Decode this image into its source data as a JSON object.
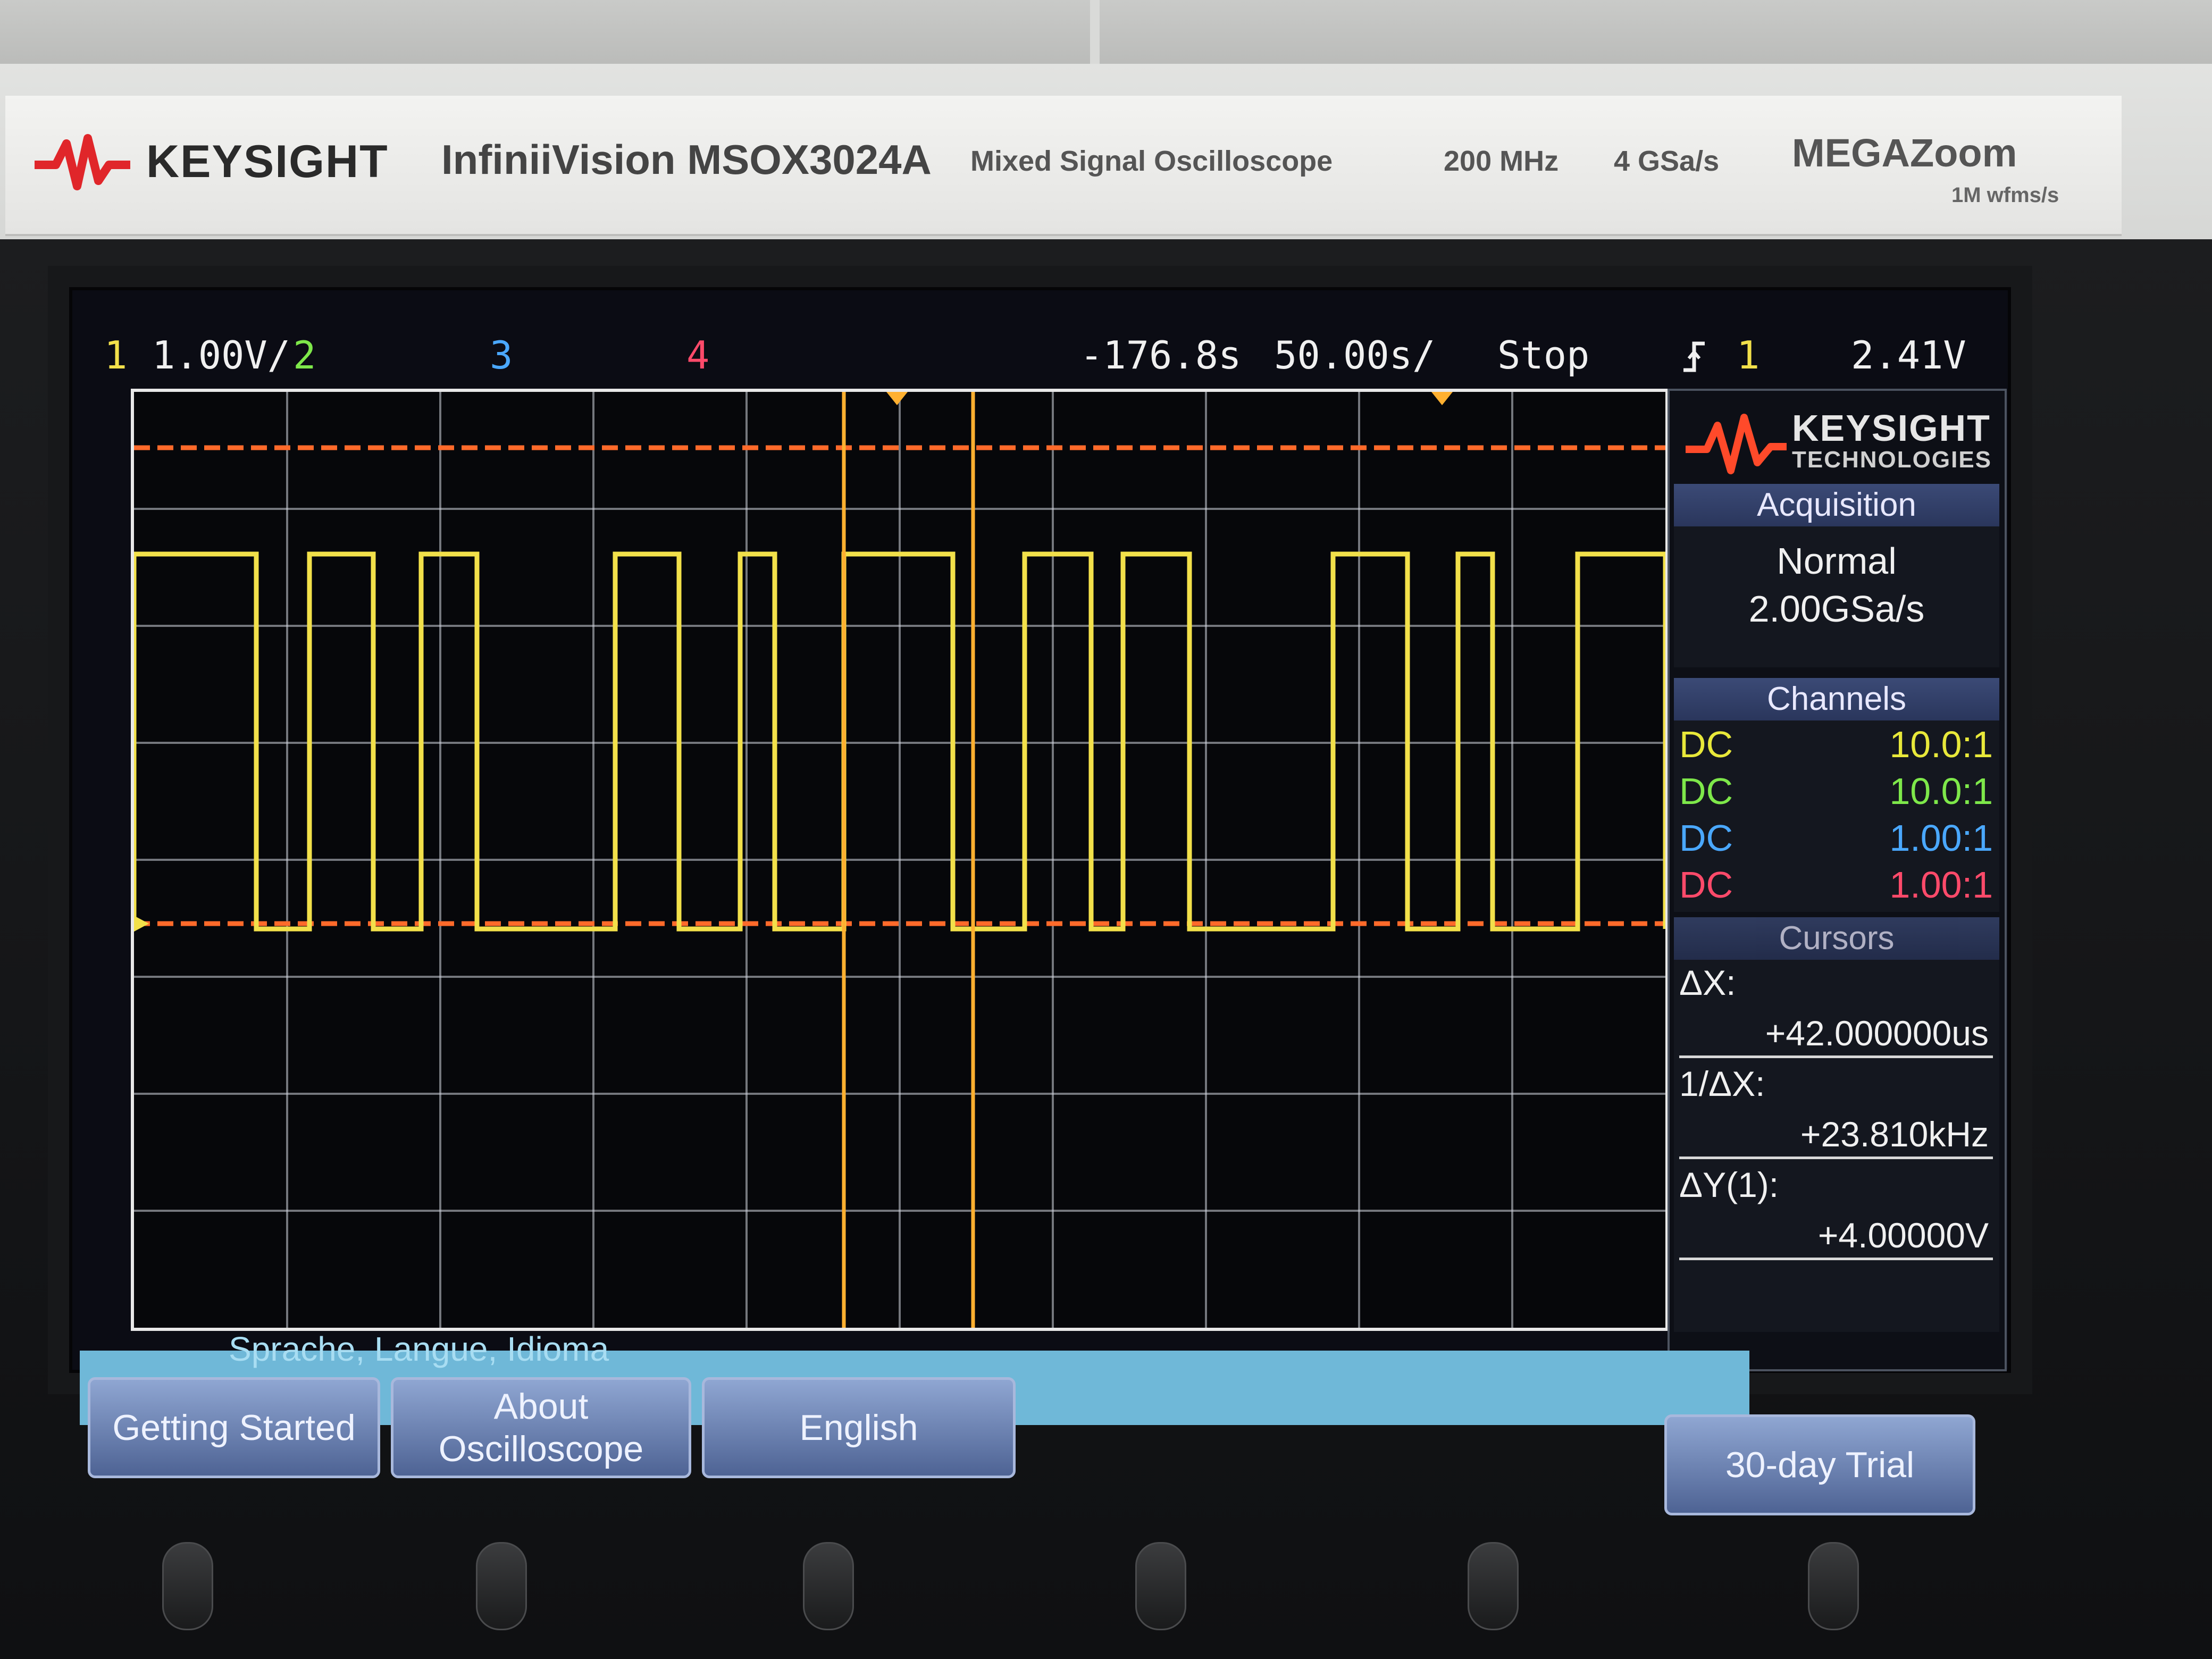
{
  "brand": {
    "name": "KEYSIGHT",
    "model": "InfiniiVision MSOX3024A",
    "description": "Mixed Signal Oscilloscope",
    "bandwidth": "200 MHz",
    "sample_rate": "4 GSa/s",
    "megazoom": "MEGAZoom",
    "megazoom_spec": "1M wfms/s"
  },
  "status": {
    "ch1_num": "1",
    "ch1_scale": "1.00V/",
    "ch2_num": "2",
    "ch3_num": "3",
    "ch4_num": "4",
    "delay": "-176.8s",
    "timebase": "50.00s/",
    "run_state": "Stop",
    "trig_source": "1",
    "trig_level": "2.41V"
  },
  "panel": {
    "logo_name": "KEYSIGHT",
    "logo_sub": "TECHNOLOGIES",
    "acquisition": {
      "title": "Acquisition",
      "mode": "Normal",
      "rate": "2.00GSa/s"
    },
    "channels": {
      "title": "Channels",
      "rows": [
        {
          "coupling": "DC",
          "probe": "10.0:1",
          "color": "#e8e83a"
        },
        {
          "coupling": "DC",
          "probe": "10.0:1",
          "color": "#7ee84a"
        },
        {
          "coupling": "DC",
          "probe": "1.00:1",
          "color": "#4aa8ff"
        },
        {
          "coupling": "DC",
          "probe": "1.00:1",
          "color": "#ff4a6a"
        }
      ]
    },
    "cursors": {
      "title": "Cursors",
      "dx_label": "ΔX:",
      "dx_value": "+42.000000us",
      "inv_dx_label": "1/ΔX:",
      "inv_dx_value": "+23.810kHz",
      "dy_label": "ΔY(1):",
      "dy_value": "+4.00000V"
    }
  },
  "softkeys": {
    "menu_label": "Sprache, Langue, Idioma",
    "getting_started": "Getting Started",
    "about_oscilloscope": "About Oscilloscope",
    "language": "English",
    "trial": "30-day Trial"
  },
  "colors": {
    "ch1": "#f2e04a",
    "ref_line": "#ff6a2a",
    "cursor": "#ffb030",
    "grid": "#cfd3dc"
  },
  "icons": [
    "keysight-wave-icon",
    "trigger-edge-icon",
    "ground-marker-icon",
    "trigger-marker-icon"
  ]
}
